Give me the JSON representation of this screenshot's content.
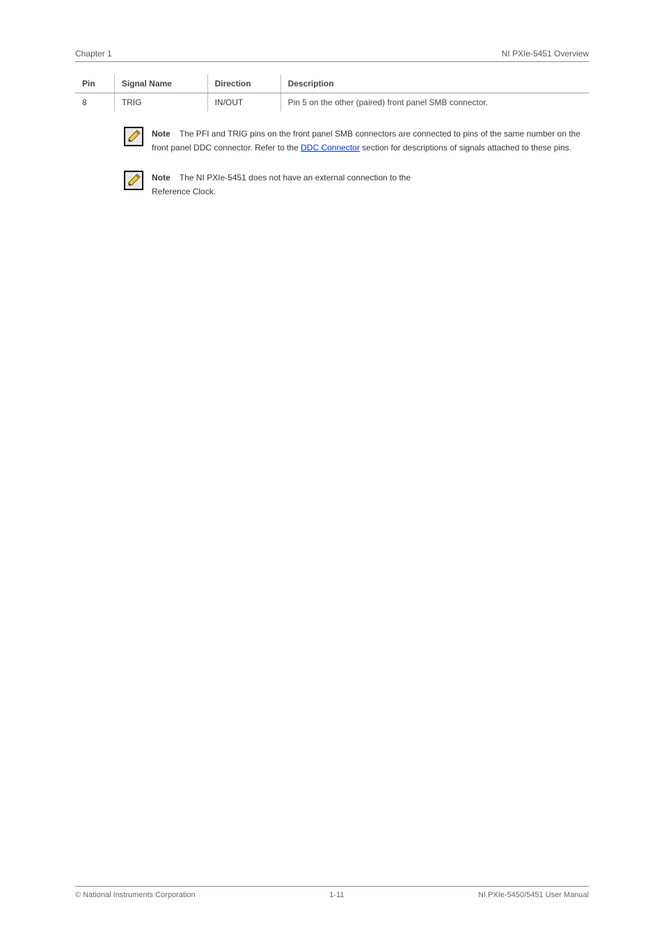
{
  "header": {
    "left": "Chapter 1",
    "right": "NI PXIe-5451 Overview"
  },
  "table": {
    "headers": [
      "Pin",
      "Signal Name",
      "Direction",
      "Description"
    ],
    "row": {
      "pin": "8",
      "signal": "TRIG",
      "direction": "IN/OUT",
      "description": "Pin 5 on the other (paired) front panel SMB connector."
    }
  },
  "note1": {
    "label": "Note",
    "prefix": "The PFI and TRIG pins on the front panel SMB connectors are connected to pins of the same number on the front panel DDC connector. Refer to the ",
    "link": "DDC Connector",
    "suffix": " section for descriptions of signals attached to these pins."
  },
  "note2": {
    "label": "Note",
    "text_line1": "The NI PXIe-5451 does not have an external connection to the",
    "text_line2": "Reference Clock."
  },
  "footer": {
    "copyright": "© National Instruments Corporation",
    "page": "1-11",
    "doc": "NI PXIe-5450/5451 User Manual"
  }
}
